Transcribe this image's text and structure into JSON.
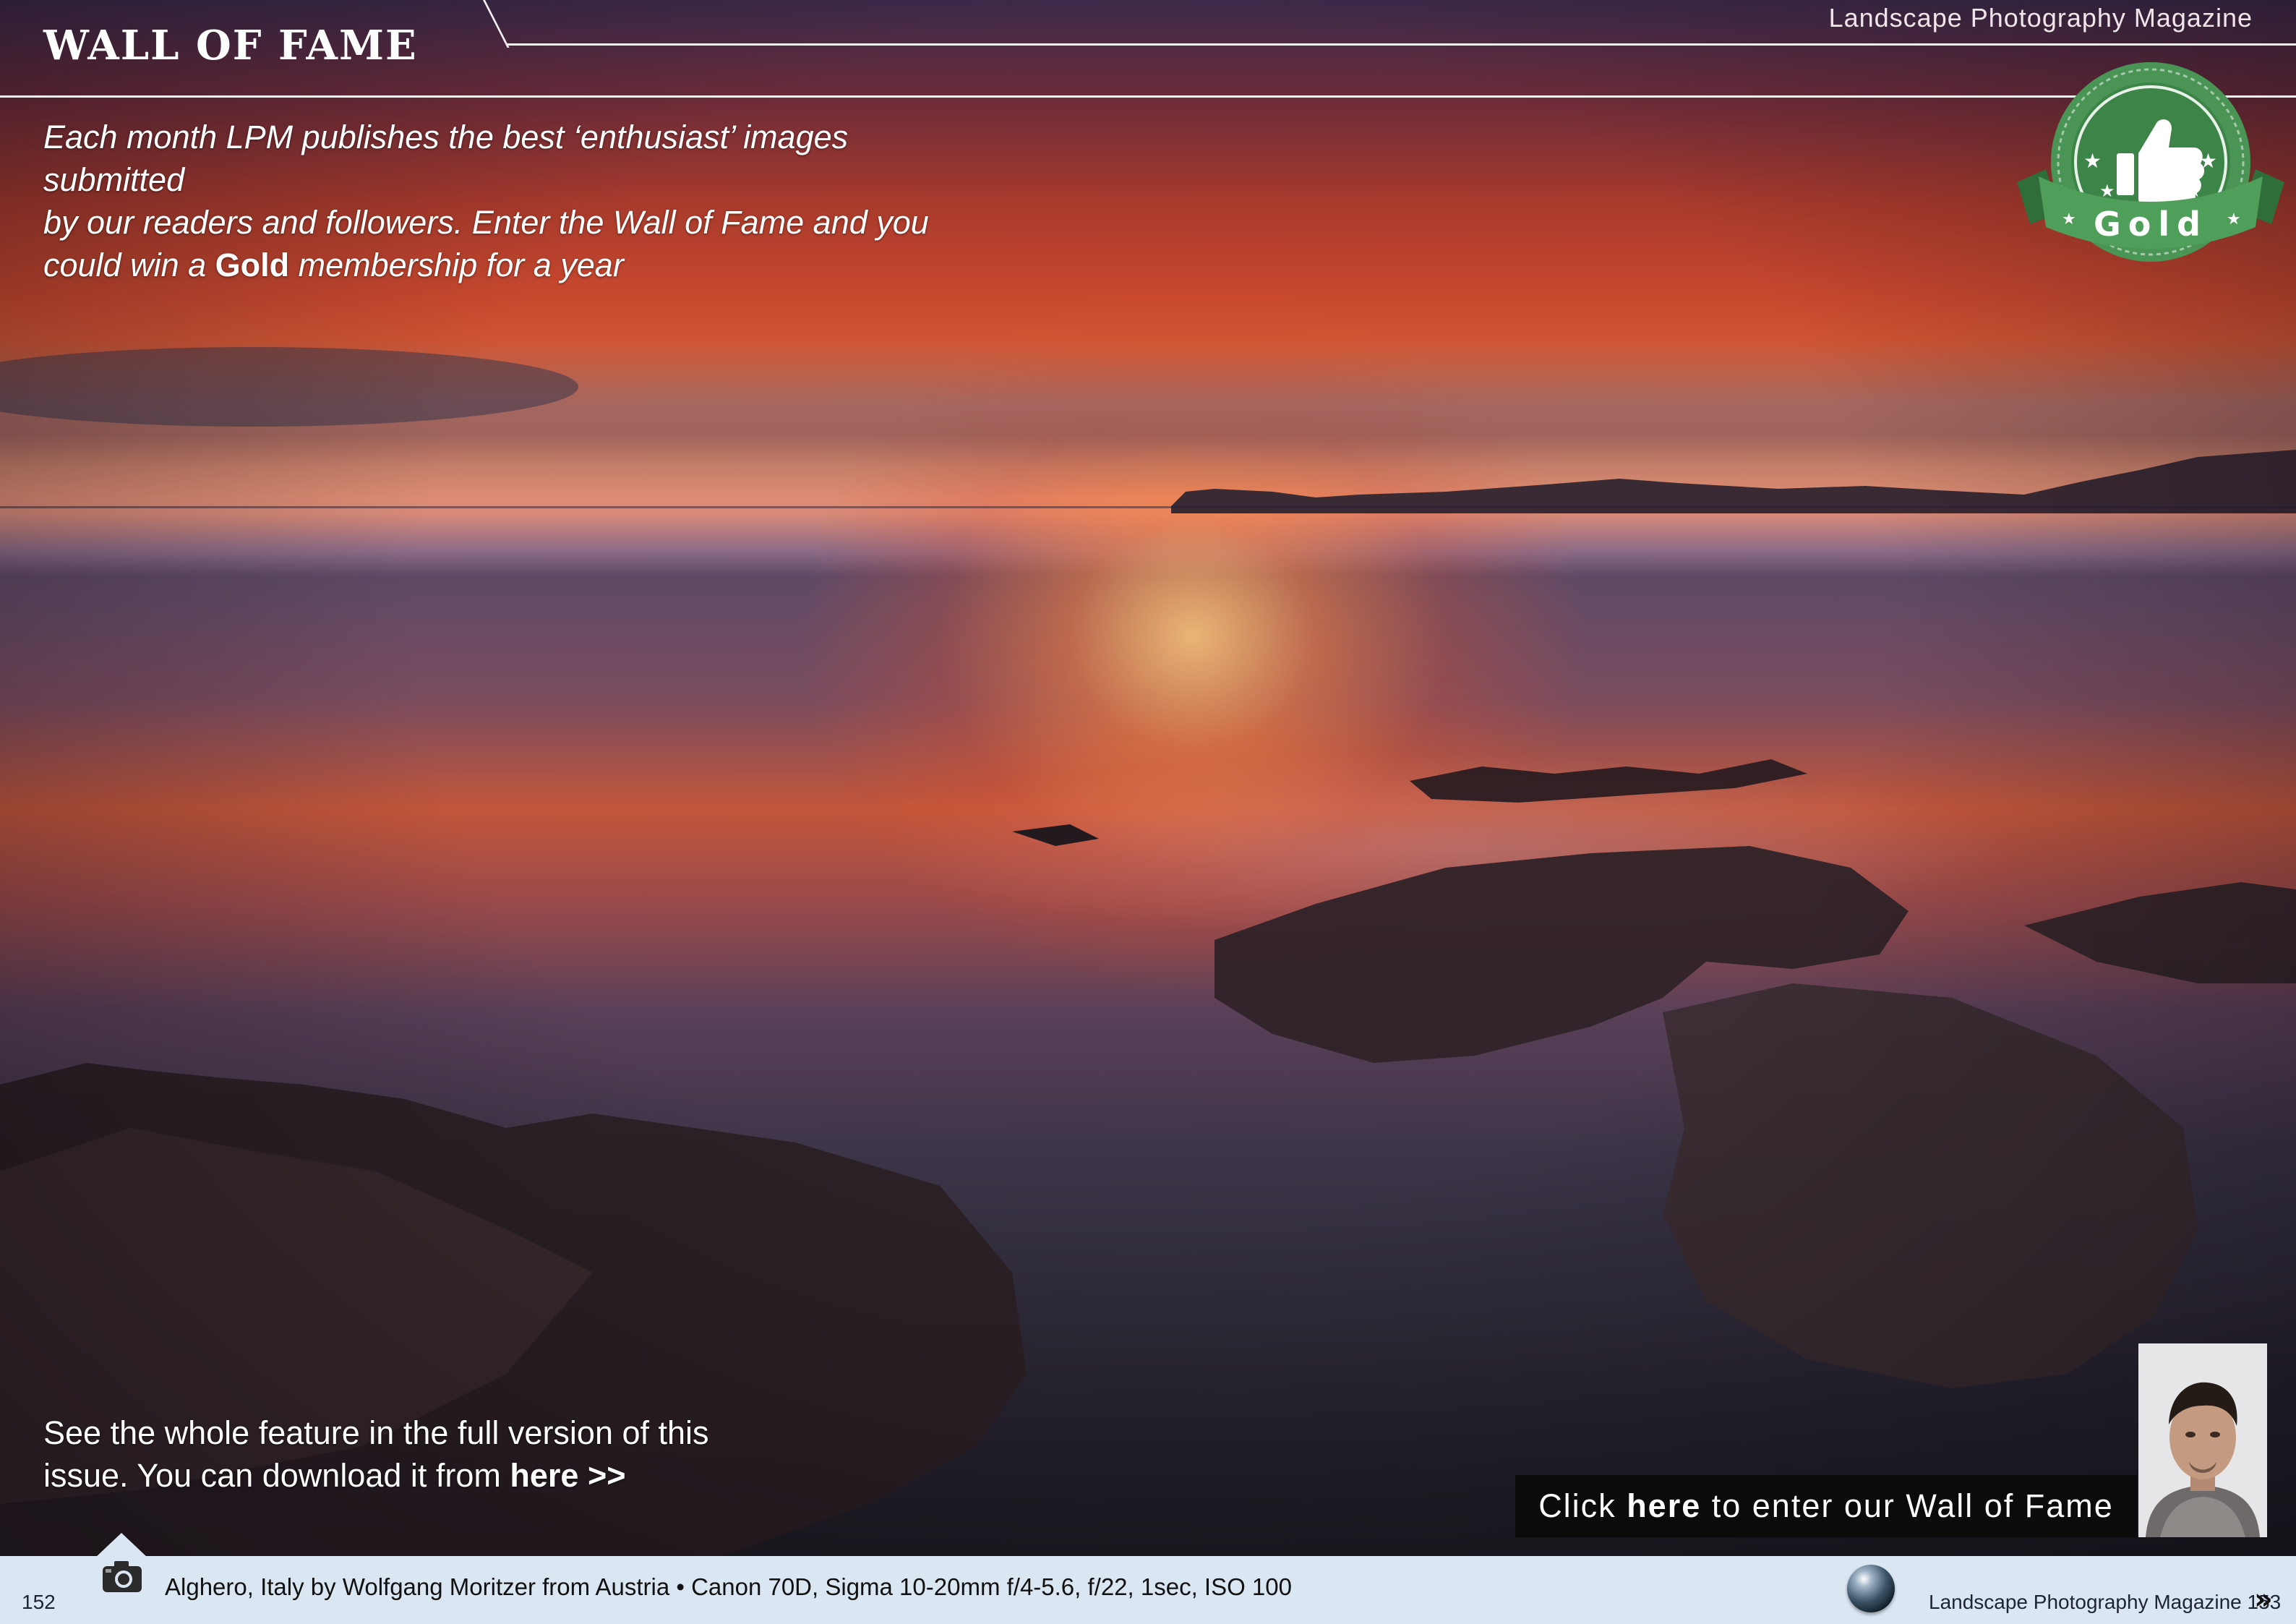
{
  "header": {
    "section_title": "WALL OF FAME",
    "magazine_name": "Landscape Photography Magazine"
  },
  "intro": {
    "line1": "Each month LPM publishes the best ‘enthusiast’ images submitted",
    "line2": "by our readers and followers. Enter the Wall of Fame and you",
    "line3_prefix": "could win a ",
    "line3_bold": "Gold",
    "line3_suffix": " membership for a year"
  },
  "badge": {
    "label": "Gold",
    "icon": "thumbs-up-icon",
    "color": "#3f8a4a"
  },
  "feature": {
    "line1": "See the whole feature in the full version of this",
    "line2_prefix": "issue. You can download it from ",
    "line2_link": "here >>"
  },
  "cta": {
    "prefix": "Click ",
    "bold": "here",
    "suffix": " to enter our Wall of Fame"
  },
  "footer": {
    "page_left": "152",
    "caption": "Alghero, Italy by Wolfgang Moritzer from Austria • Canon 70D, Sigma 10-20mm f/4-5.6, f/22, 1sec, ISO 100",
    "magazine_page": "Landscape Photography Magazine 153",
    "next_icon": "double-chevron-right-icon",
    "camera_icon": "camera-icon",
    "globe_icon": "globe-icon",
    "bg_color": "#dbe6f3"
  }
}
